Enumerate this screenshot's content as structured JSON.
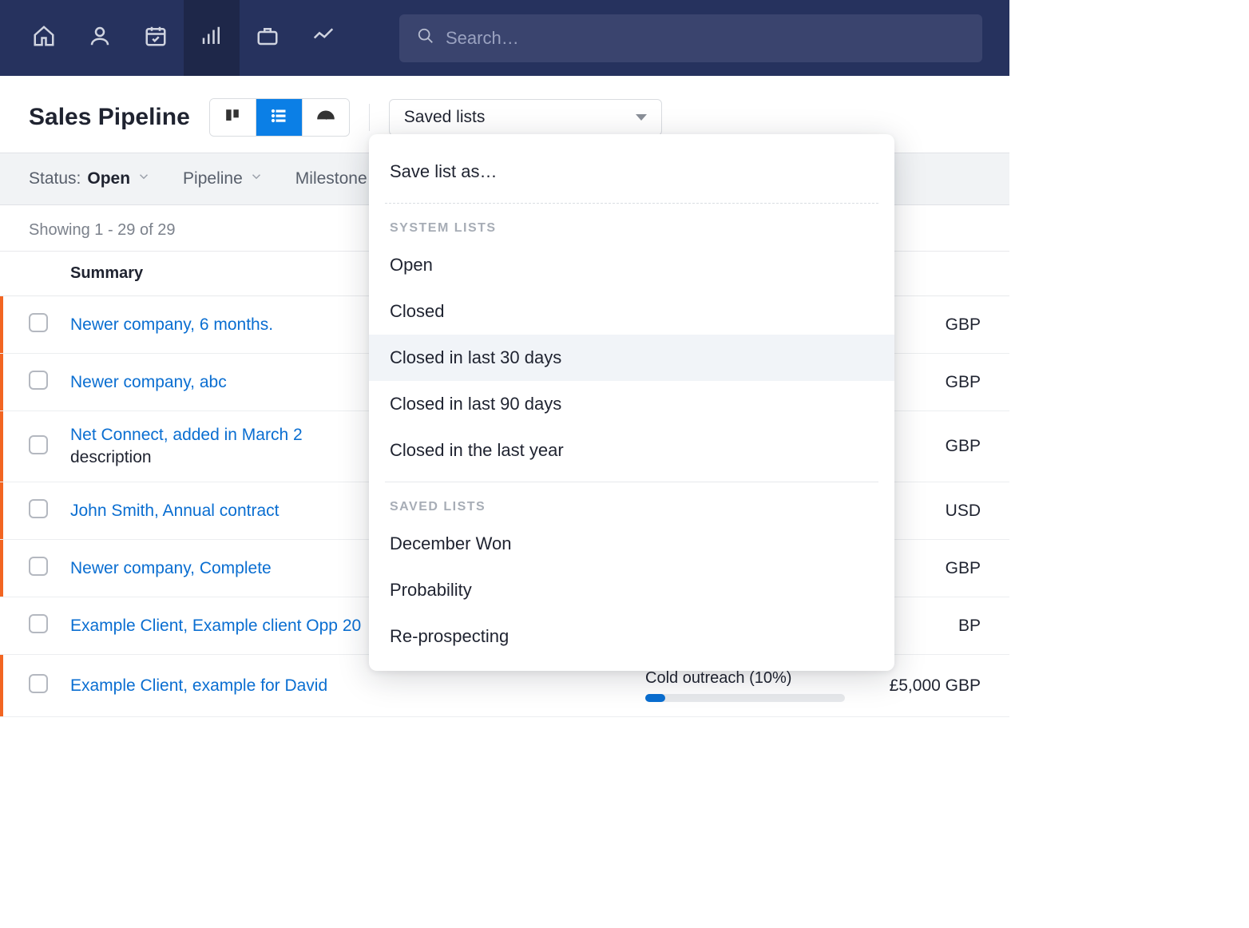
{
  "nav": {
    "search_placeholder": "Search…",
    "icons": [
      "home",
      "person",
      "calendar",
      "pipeline",
      "case",
      "activity"
    ]
  },
  "header": {
    "title": "Sales Pipeline",
    "saved_lists_label": "Saved lists"
  },
  "filters": {
    "status_label": "Status:",
    "status_value": "Open",
    "pipeline_label": "Pipeline",
    "milestone_label": "Milestone"
  },
  "showing": "Showing 1 - 29 of 29",
  "columns": {
    "summary": "Summary"
  },
  "rows": [
    {
      "summary": "Newer company, 6 months.",
      "sub": "",
      "value": "GBP",
      "bar": true
    },
    {
      "summary": "Newer company, abc",
      "sub": "",
      "value": "GBP",
      "bar": true
    },
    {
      "summary": "Net Connect, added in March 2",
      "sub": "description",
      "value": "GBP",
      "bar": true
    },
    {
      "summary": "John Smith, Annual contract",
      "sub": "",
      "value": "USD",
      "bar": true
    },
    {
      "summary": "Newer company, Complete",
      "sub": "",
      "value": "GBP",
      "bar": true
    },
    {
      "summary": "Example Client, Example client Opp 20",
      "sub": "",
      "value": "BP",
      "bar": false
    },
    {
      "summary": "Example Client, example for David",
      "sub": "",
      "milestone": "Cold outreach (10%)",
      "value": "£5,000 GBP",
      "bar": true
    }
  ],
  "dropdown": {
    "save_as": "Save list as…",
    "system_heading": "SYSTEM LISTS",
    "system": [
      "Open",
      "Closed",
      "Closed in last 30 days",
      "Closed in last 90 days",
      "Closed in the last year"
    ],
    "saved_heading": "SAVED LISTS",
    "saved": [
      "December Won",
      "Probability",
      "Re-prospecting"
    ]
  }
}
